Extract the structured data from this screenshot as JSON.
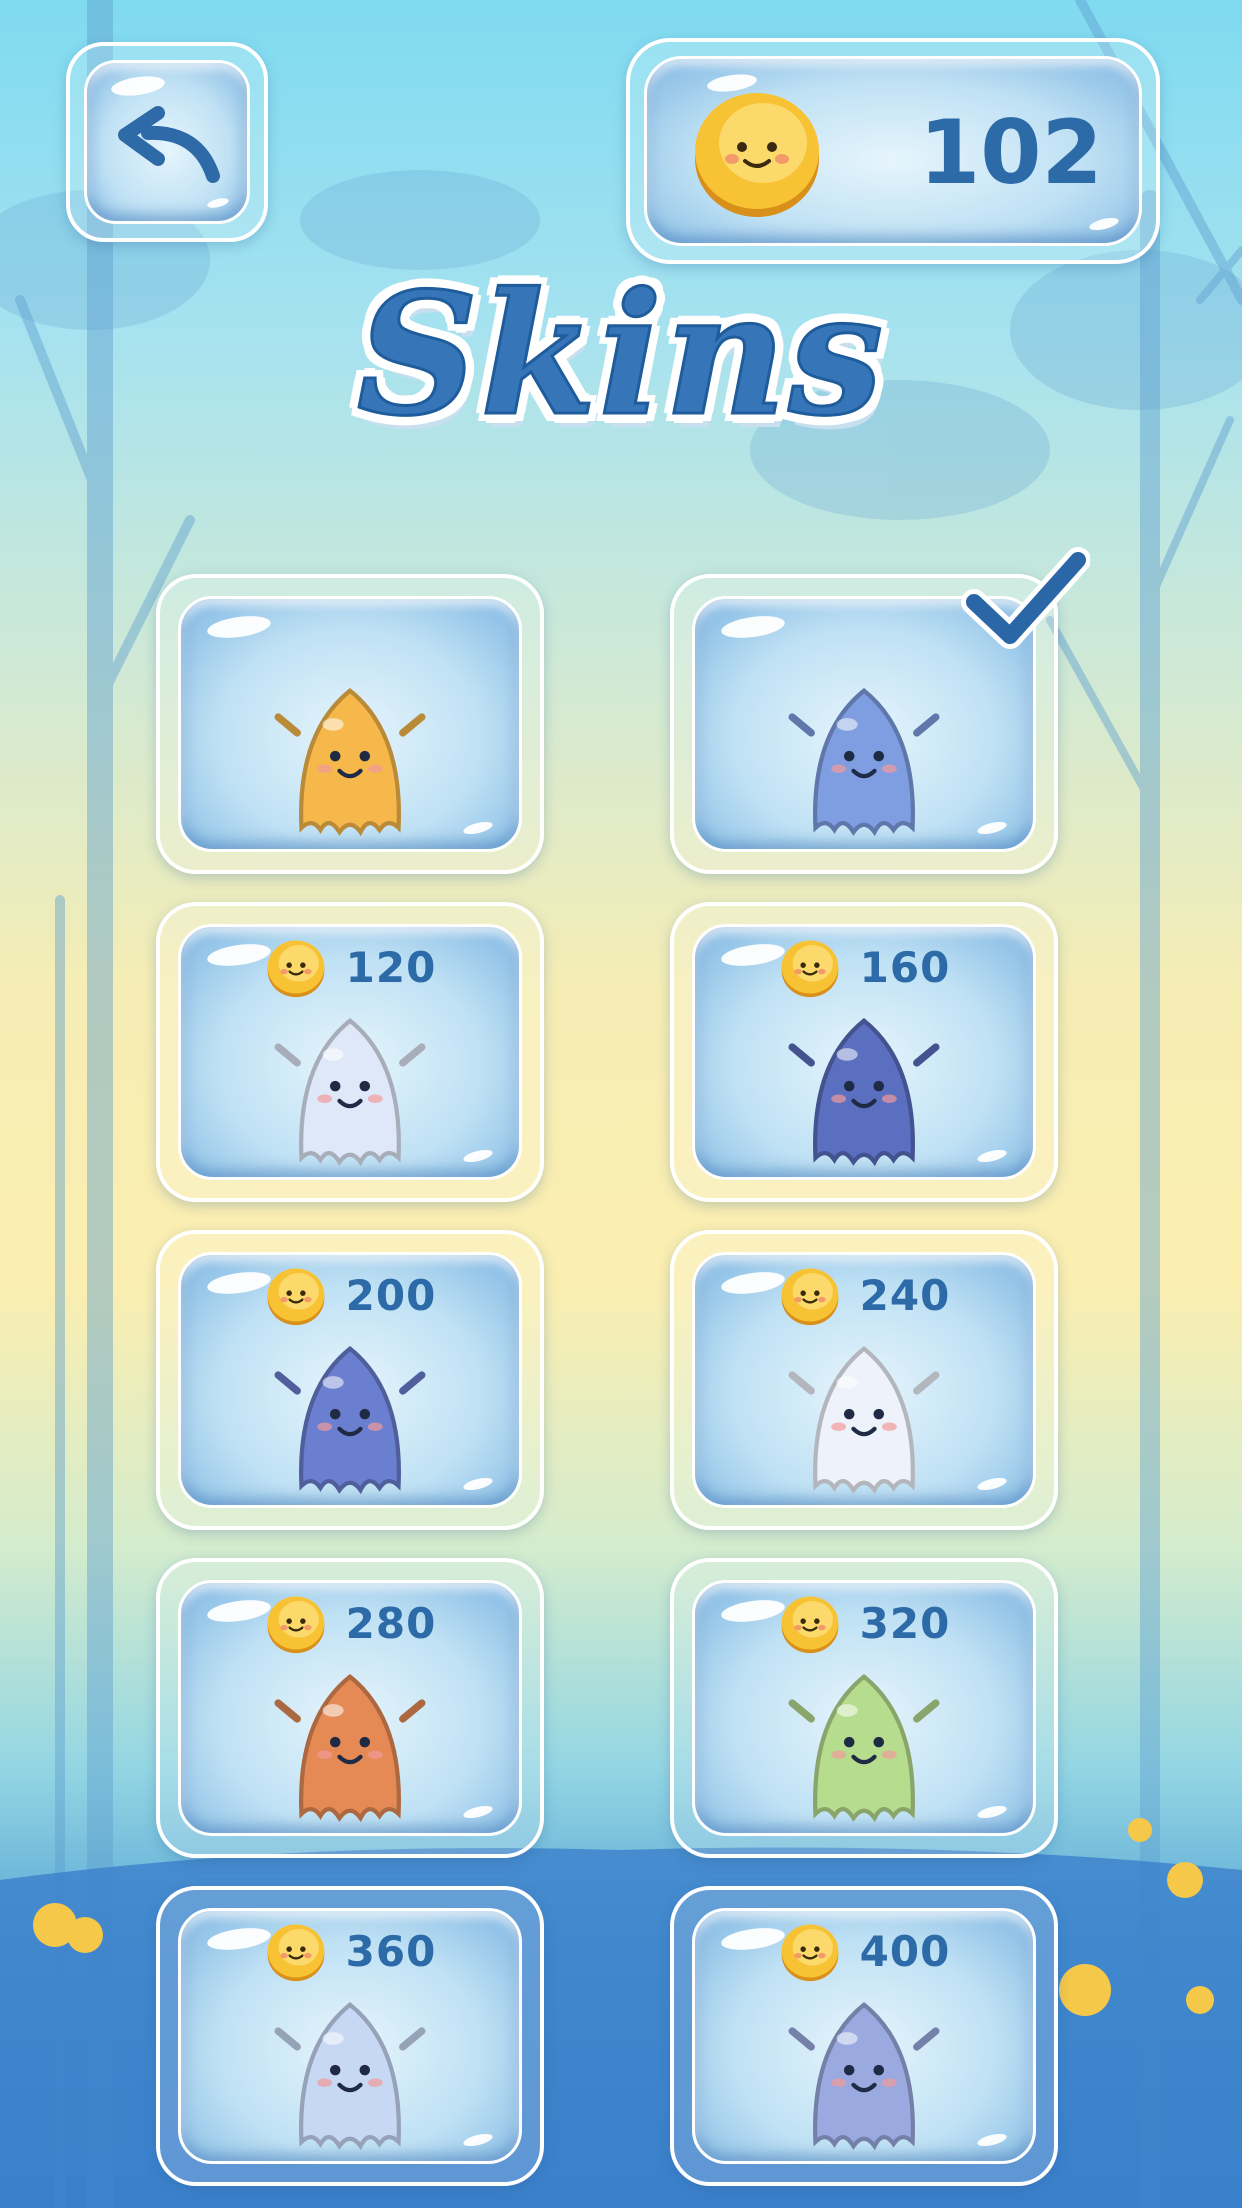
{
  "header": {
    "back_icon": "arrow-left-icon",
    "coin_icon": "smiling-coin-icon",
    "coin_balance": "102"
  },
  "title": "Skins",
  "selected_icon": "checkmark-icon",
  "skins": [
    {
      "price": "",
      "color": "#f6b84a",
      "owned": true,
      "selected": false
    },
    {
      "price": "",
      "color": "#7f9ee2",
      "owned": true,
      "selected": true
    },
    {
      "price": "120",
      "color": "#dfe8f8",
      "owned": false,
      "selected": false
    },
    {
      "price": "160",
      "color": "#5b6fc0",
      "owned": false,
      "selected": false
    },
    {
      "price": "200",
      "color": "#6a7fcf",
      "owned": false,
      "selected": false
    },
    {
      "price": "240",
      "color": "#eef2fb",
      "owned": false,
      "selected": false
    },
    {
      "price": "280",
      "color": "#e58a55",
      "owned": false,
      "selected": false
    },
    {
      "price": "320",
      "color": "#b6dc8e",
      "owned": false,
      "selected": false
    },
    {
      "price": "360",
      "color": "#c6d8f4",
      "owned": false,
      "selected": false
    },
    {
      "price": "400",
      "color": "#9aaae0",
      "owned": false,
      "selected": false
    }
  ]
}
